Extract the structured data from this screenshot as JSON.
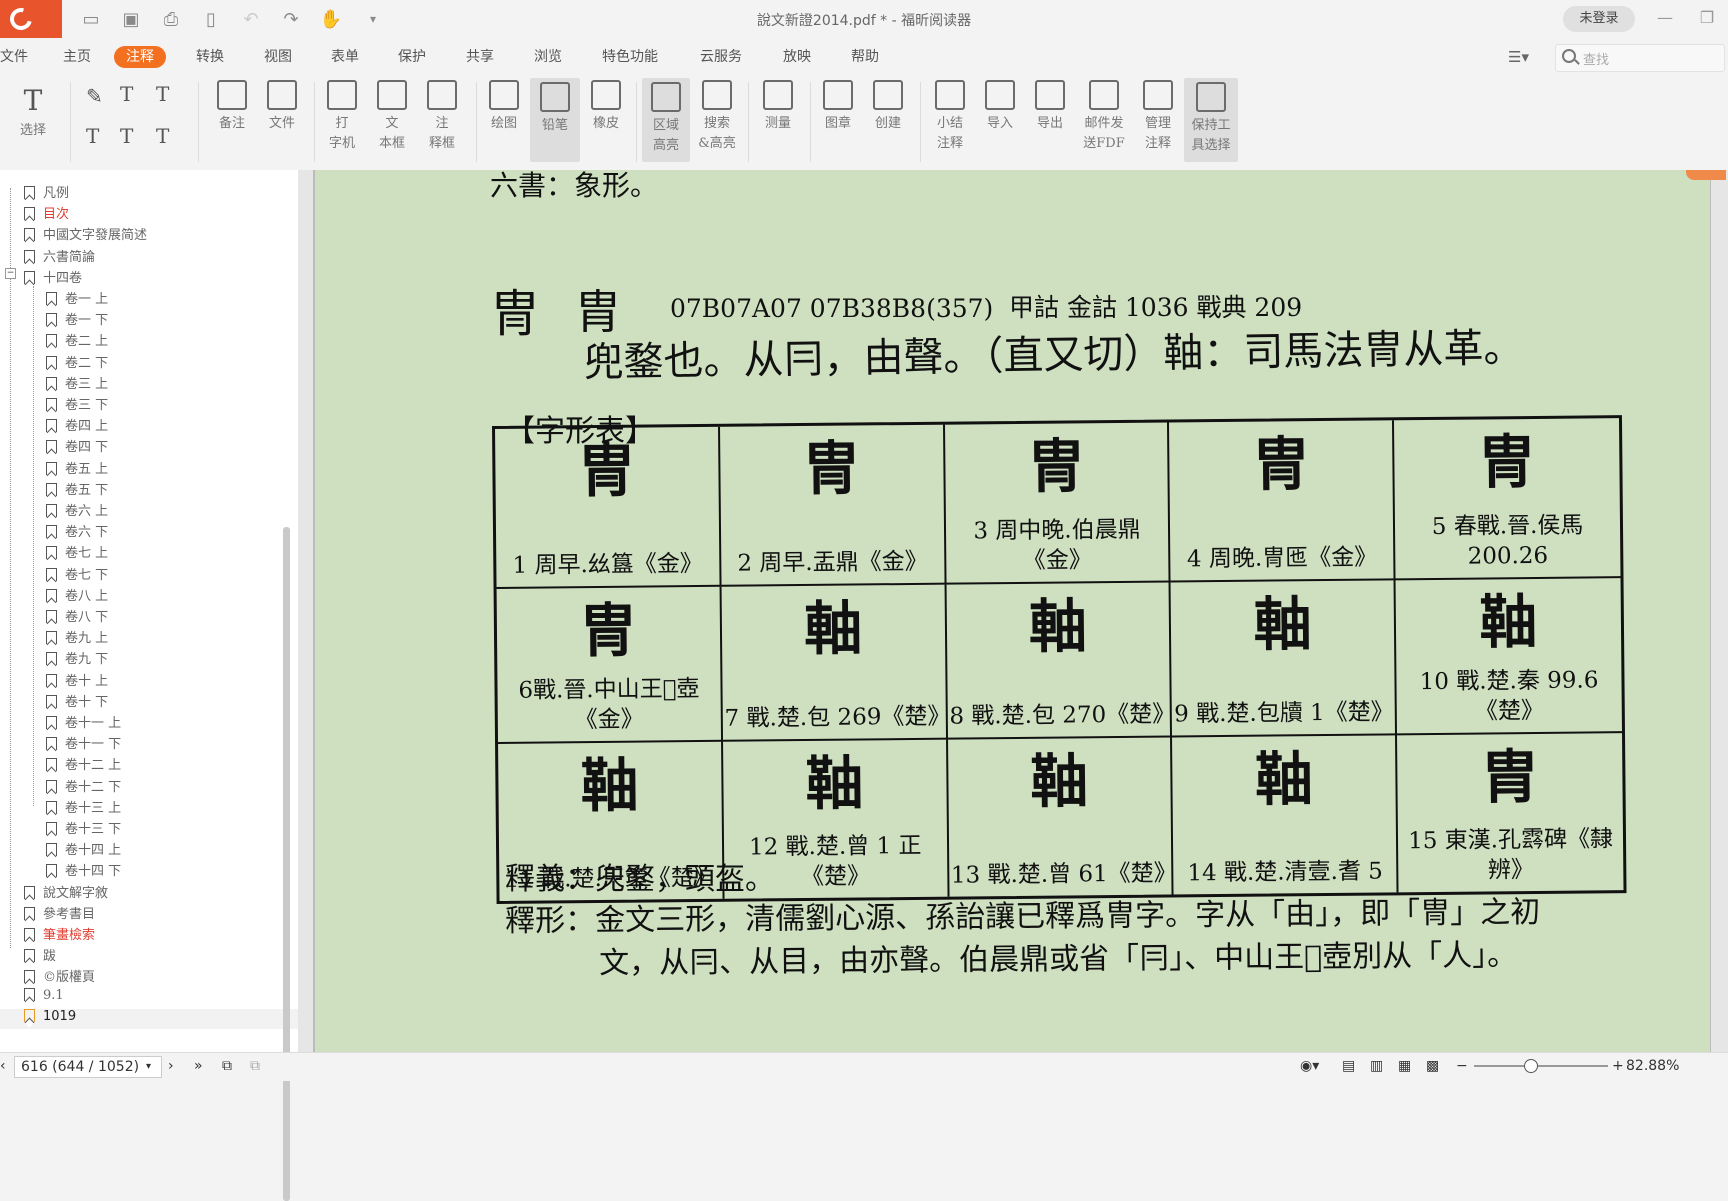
{
  "titlebar": {
    "title": "說文新證2014.pdf * - 福昕阅读器",
    "login": "未登录"
  },
  "menu": {
    "tabs": [
      "文件",
      "主页",
      "注释",
      "转换",
      "视图",
      "表单",
      "保护",
      "共享",
      "浏览",
      "特色功能",
      "云服务",
      "放映",
      "帮助"
    ],
    "active": "注释",
    "search_placeholder": "查找"
  },
  "ribbon": {
    "buttons": [
      "选择",
      "备注",
      "文件",
      "打\n字机",
      "文\n本框",
      "注\n释框",
      "绘图",
      "铅笔",
      "橡皮",
      "区域\n高亮",
      "搜索\n&高亮",
      "测量",
      "图章",
      "创建",
      "小结\n注释",
      "导入",
      "导出",
      "邮件发\n送FDF",
      "管理\n注释",
      "保持工\n具选择"
    ]
  },
  "bookmarks": [
    {
      "label": "凡例",
      "level": 0
    },
    {
      "label": "目次",
      "level": 0,
      "color": "#e23c2f"
    },
    {
      "label": "中國文字發展简述",
      "level": 0
    },
    {
      "label": "六書简論",
      "level": 0
    },
    {
      "label": "十四卷",
      "level": 0,
      "expanded": true
    },
    {
      "label": "卷一 上",
      "level": 1
    },
    {
      "label": "卷一 下",
      "level": 1
    },
    {
      "label": "卷二 上",
      "level": 1
    },
    {
      "label": "卷二 下",
      "level": 1
    },
    {
      "label": "卷三 上",
      "level": 1
    },
    {
      "label": "卷三 下",
      "level": 1
    },
    {
      "label": "卷四 上",
      "level": 1
    },
    {
      "label": "卷四 下",
      "level": 1
    },
    {
      "label": "卷五 上",
      "level": 1
    },
    {
      "label": "卷五 下",
      "level": 1
    },
    {
      "label": "卷六 上",
      "level": 1
    },
    {
      "label": "卷六 下",
      "level": 1
    },
    {
      "label": "卷七 上",
      "level": 1
    },
    {
      "label": "卷七 下",
      "level": 1
    },
    {
      "label": "卷八 上",
      "level": 1
    },
    {
      "label": "卷八 下",
      "level": 1
    },
    {
      "label": "卷九 上",
      "level": 1
    },
    {
      "label": "卷九 下",
      "level": 1
    },
    {
      "label": "卷十 上",
      "level": 1
    },
    {
      "label": "卷十 下",
      "level": 1
    },
    {
      "label": "卷十一 上",
      "level": 1
    },
    {
      "label": "卷十一 下",
      "level": 1
    },
    {
      "label": "卷十二 上",
      "level": 1
    },
    {
      "label": "卷十二 下",
      "level": 1
    },
    {
      "label": "卷十三 上",
      "level": 1
    },
    {
      "label": "卷十三 下",
      "level": 1
    },
    {
      "label": "卷十四 上",
      "level": 1
    },
    {
      "label": "卷十四 下",
      "level": 1
    },
    {
      "label": "說文解字敘",
      "level": 0
    },
    {
      "label": "參考書目",
      "level": 0
    },
    {
      "label": "筆畫檢索",
      "level": 0,
      "color": "#e23c2f"
    },
    {
      "label": "跋",
      "level": 0
    },
    {
      "label": "©版權頁",
      "level": 0
    },
    {
      "label": "9.1",
      "level": 0
    },
    {
      "label": "1019",
      "level": 0,
      "selected": true
    }
  ],
  "page": {
    "top_line": "六書：象形。",
    "head_seal": "冑",
    "head_char": "胄",
    "codes": "07B07A07   07B38B8(357)",
    "refs": "甲詁   金詁 1036    戰典 209",
    "definition": "兜鍪也。从冃，由聲。（直又切）䩜：司馬法冑从革。",
    "table_title": "【字形表】",
    "table": [
      {
        "glyph": "冑",
        "caption": "1 周早.𢆶簋《金》"
      },
      {
        "glyph": "冑",
        "caption": "2 周早.盂鼎《金》"
      },
      {
        "glyph": "冑",
        "caption": "3 周中晚.伯晨鼎《金》"
      },
      {
        "glyph": "冑",
        "caption": "4 周晚.冑匜《金》"
      },
      {
        "glyph": "冑",
        "caption": "5 春戰.晉.侯馬200.26"
      },
      {
        "glyph": "冑",
        "caption": "6戰.晉.中山王𠑇壺《金》"
      },
      {
        "glyph": "軸",
        "caption": "7 戰.楚.包 269《楚》"
      },
      {
        "glyph": "軸",
        "caption": "8 戰.楚.包 270《楚》"
      },
      {
        "glyph": "軸",
        "caption": "9 戰.楚.包牘 1《楚》"
      },
      {
        "glyph": "䩜",
        "caption": "10 戰.楚.秦 99.6《楚》"
      },
      {
        "glyph": "䩜",
        "caption": "11 戰.楚.天策《楚》"
      },
      {
        "glyph": "䩜",
        "caption": "12 戰.楚.曾 1 正《楚》"
      },
      {
        "glyph": "䩜",
        "caption": "13 戰.楚.曾 61《楚》"
      },
      {
        "glyph": "䩜",
        "caption": "14 戰.楚.清壹.耆 5"
      },
      {
        "glyph": "胄",
        "caption": "15 東漢.孔𩃬碑《隸辨》"
      }
    ],
    "shiyi": "釋義：兜鍪，頭盔。",
    "shixing": "釋形：金文三形，清儒劉心源、孫詒讓已釋爲冑字。字从「由」，即「冑」之初",
    "shixing2": "文，从冃、从目，由亦聲。伯晨鼎或省「冃」、中山王𠑇壺別从「人」。"
  },
  "status": {
    "page_indicator": "616 (644 / 1052)",
    "zoom": "82.88%"
  }
}
